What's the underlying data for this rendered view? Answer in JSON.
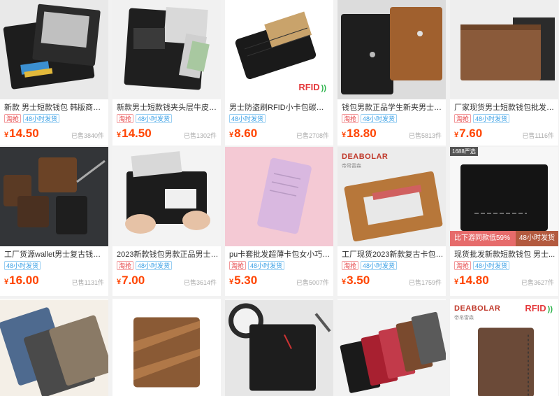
{
  "products": [
    {
      "title": "新款 男士短款钱包 韩版商务多...",
      "tags": [
        {
          "text": "淘抢",
          "style": "red"
        },
        {
          "text": "48小时发货",
          "style": "blue"
        }
      ],
      "currency": "¥",
      "price": "14.50",
      "sold": "已售3840件"
    },
    {
      "title": "新款男士短款钱夹头层牛皮竖款...",
      "tags": [
        {
          "text": "淘抢",
          "style": "red"
        },
        {
          "text": "48小时发货",
          "style": "blue"
        }
      ],
      "currency": "¥",
      "price": "14.50",
      "sold": "已售1302件"
    },
    {
      "title": "男士防盗刷RFID小卡包碳纤维...",
      "tags": [
        {
          "text": "48小时发货",
          "style": "blue"
        }
      ],
      "currency": "¥",
      "price": "8.60",
      "sold": "已售2708件",
      "badge": "RFID"
    },
    {
      "title": "钱包男款正品学生新夹男士短款...",
      "tags": [
        {
          "text": "淘抢",
          "style": "red"
        },
        {
          "text": "48小时发货",
          "style": "blue"
        }
      ],
      "currency": "¥",
      "price": "18.80",
      "sold": "已售5813件"
    },
    {
      "title": "厂家现货男士短款钱包批发时尚...",
      "tags": [
        {
          "text": "淘抢",
          "style": "red"
        },
        {
          "text": "48小时发货",
          "style": "blue"
        }
      ],
      "currency": "¥",
      "price": "7.60",
      "sold": "已售1116件"
    },
    {
      "title": "工厂货源wallet男士复古钱包短...",
      "tags": [
        {
          "text": "48小时发货",
          "style": "blue"
        }
      ],
      "currency": "¥",
      "price": "16.00",
      "sold": "已售1131件"
    },
    {
      "title": "2023新款钱包男款正品男士短款...",
      "tags": [
        {
          "text": "淘抢",
          "style": "red"
        },
        {
          "text": "48小时发货",
          "style": "blue"
        }
      ],
      "currency": "¥",
      "price": "7.00",
      "sold": "已售3614件"
    },
    {
      "title": "pu卡套批发超薄卡包女小巧精致...",
      "tags": [
        {
          "text": "淘抢",
          "style": "red"
        },
        {
          "text": "48小时发货",
          "style": "blue"
        }
      ],
      "currency": "¥",
      "price": "5.30",
      "sold": "已售5007件"
    },
    {
      "title": "工厂现货2023新款复古卡包男...",
      "tags": [
        {
          "text": "淘抢",
          "style": "red"
        },
        {
          "text": "48小时发货",
          "style": "blue"
        }
      ],
      "currency": "¥",
      "price": "3.50",
      "sold": "已售1759件",
      "brand": "DEABOLAR",
      "brand_sub": "帝帛雷森"
    },
    {
      "title": "现货批发新款短款钱包 男士...",
      "tags": [
        {
          "text": "淘抢",
          "style": "red"
        },
        {
          "text": "48小时发货",
          "style": "blue"
        }
      ],
      "currency": "¥",
      "price": "14.80",
      "sold": "已售3627件",
      "store_tag": "1688严选",
      "promo": "比下游同款低59%",
      "promo_days": "48小时发货"
    },
    {
      "title": "",
      "tags": [],
      "currency": "",
      "price": "",
      "sold": ""
    },
    {
      "title": "",
      "tags": [],
      "currency": "",
      "price": "",
      "sold": ""
    },
    {
      "title": "",
      "tags": [],
      "currency": "",
      "price": "",
      "sold": ""
    },
    {
      "title": "",
      "tags": [],
      "currency": "",
      "price": "",
      "sold": ""
    },
    {
      "title": "",
      "tags": [],
      "currency": "",
      "price": "",
      "sold": "",
      "brand": "DEABOLAR",
      "brand_sub": "帝帛雷森",
      "badge": "RFID"
    }
  ]
}
